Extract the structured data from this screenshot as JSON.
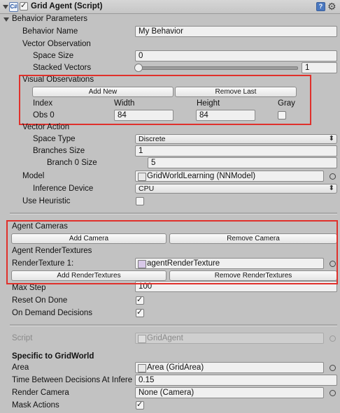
{
  "header": {
    "title": "Grid Agent (Script)",
    "enabled": true
  },
  "behavior_parameters": {
    "section_label": "Behavior Parameters",
    "behavior_name_label": "Behavior Name",
    "behavior_name_value": "My Behavior",
    "vector_observation_label": "Vector Observation",
    "space_size_label": "Space Size",
    "space_size_value": "0",
    "stacked_vectors_label": "Stacked Vectors",
    "stacked_vectors_value": "1",
    "visual_observations": {
      "label": "Visual Observations",
      "add_new": "Add New",
      "remove_last": "Remove Last",
      "col_index": "Index",
      "col_width": "Width",
      "col_height": "Height",
      "col_gray": "Gray",
      "row_label": "Obs 0",
      "width_value": "84",
      "height_value": "84",
      "gray_checked": false
    },
    "vector_action_label": "Vector Action",
    "space_type_label": "Space Type",
    "space_type_value": "Discrete",
    "branches_size_label": "Branches Size",
    "branches_size_value": "1",
    "branch0_label": "Branch 0 Size",
    "branch0_value": "5",
    "model_label": "Model",
    "model_value": "GridWorldLearning (NNModel)",
    "inference_device_label": "Inference Device",
    "inference_device_value": "CPU",
    "use_heuristic_label": "Use Heuristic",
    "use_heuristic_checked": false
  },
  "agent_cameras": {
    "label": "Agent Cameras",
    "add_camera": "Add Camera",
    "remove_camera": "Remove Camera",
    "render_textures_label": "Agent RenderTextures",
    "render_texture_label": "RenderTexture 1:",
    "render_texture_value": "agentRenderTexture",
    "add_render_textures": "Add RenderTextures",
    "remove_render_textures": "Remove RenderTextures"
  },
  "agent_settings": {
    "max_step_label": "Max Step",
    "max_step_value": "100",
    "reset_on_done_label": "Reset On Done",
    "reset_on_done_checked": true,
    "on_demand_label": "On Demand Decisions",
    "on_demand_checked": true
  },
  "script": {
    "label": "Script",
    "value": "GridAgent"
  },
  "gridworld": {
    "section_label": "Specific to GridWorld",
    "area_label": "Area",
    "area_value": "Area (GridArea)",
    "time_between_label": "Time Between Decisions At Infere",
    "time_between_value": "0.15",
    "render_camera_label": "Render Camera",
    "render_camera_value": "None (Camera)",
    "mask_actions_label": "Mask Actions",
    "mask_actions_checked": true
  },
  "colors": {
    "highlight": "#e0302b",
    "background": "#c2c2c2"
  }
}
